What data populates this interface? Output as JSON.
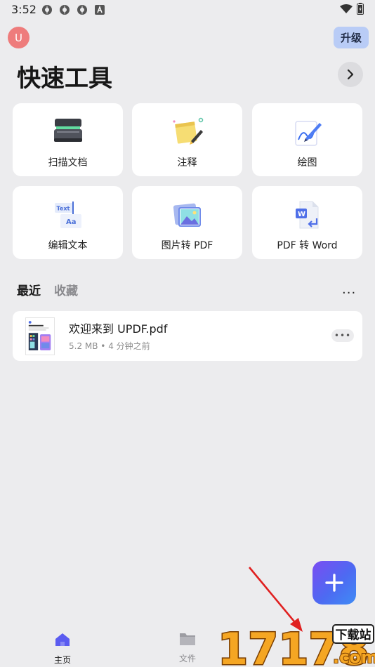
{
  "status_bar": {
    "time": "3:52",
    "notification_icons": [
      "updf-notification-icon",
      "updf-notification-icon",
      "updf-notification-icon",
      "text-notification-icon"
    ],
    "indicator_icons": [
      "wifi-icon",
      "battery-icon"
    ]
  },
  "header": {
    "avatar_initial": "U",
    "upgrade_label": "升级",
    "title": "快速工具"
  },
  "tools": [
    {
      "label": "扫描文档",
      "icon": "scanner-icon"
    },
    {
      "label": "注释",
      "icon": "sticky-note-icon"
    },
    {
      "label": "绘图",
      "icon": "drawing-pen-icon"
    },
    {
      "label": "编辑文本",
      "icon": "edit-text-icon"
    },
    {
      "label": "图片转 PDF",
      "icon": "image-to-pdf-icon"
    },
    {
      "label": "PDF 转 Word",
      "icon": "pdf-to-word-icon"
    }
  ],
  "recent": {
    "tab_recent": "最近",
    "tab_favorites": "收藏",
    "more": "...",
    "files": [
      {
        "name": "欢迎来到 UPDF.pdf",
        "meta": "5.2 MB • 4 分钟之前"
      }
    ]
  },
  "fab": {
    "icon": "plus-icon"
  },
  "bottom_nav": {
    "home_label": "主页",
    "files_label": "文件"
  },
  "watermark": {
    "number": "17178",
    "badge": "下载站",
    "domain": ".com"
  },
  "colors": {
    "background": "#ececee",
    "card": "#ffffff",
    "accent": "#5b5cf0",
    "upgrade_bg": "#b9ccf6",
    "avatar_bg": "#ee7c7c",
    "arrow": "#e02020"
  }
}
